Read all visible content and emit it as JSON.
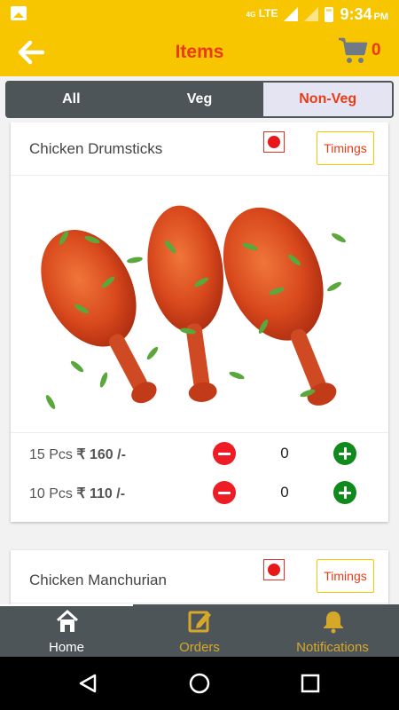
{
  "status_bar": {
    "network": "LTE",
    "network_sub": "4G",
    "time": "9:34",
    "ampm": "PM"
  },
  "app_bar": {
    "title": "Items",
    "cart_count": "0"
  },
  "tabs": [
    {
      "label": "All",
      "active": false
    },
    {
      "label": "Veg",
      "active": false
    },
    {
      "label": "Non-Veg",
      "active": true
    }
  ],
  "items": [
    {
      "name": "Chicken Drumsticks",
      "timings_label": "Timings",
      "variants": [
        {
          "qty_label": "15 Pcs",
          "price": "₹ 160 /-",
          "quantity": "0"
        },
        {
          "qty_label": "10 Pcs",
          "price": "₹ 110 /-",
          "quantity": "0"
        }
      ]
    },
    {
      "name": "Chicken Manchurian",
      "timings_label": "Timings"
    }
  ],
  "bottom_nav": [
    {
      "label": "Home",
      "icon": "home-icon",
      "active": true
    },
    {
      "label": "Orders",
      "icon": "edit-icon",
      "active": false
    },
    {
      "label": "Notifications",
      "icon": "bell-icon",
      "active": false
    }
  ],
  "colors": {
    "brand_yellow": "#f7c600",
    "accent_orange": "#ea3b16",
    "dark_gray": "#4d5559",
    "nonveg_red": "#e8171a",
    "plus_green": "#108a1c"
  }
}
